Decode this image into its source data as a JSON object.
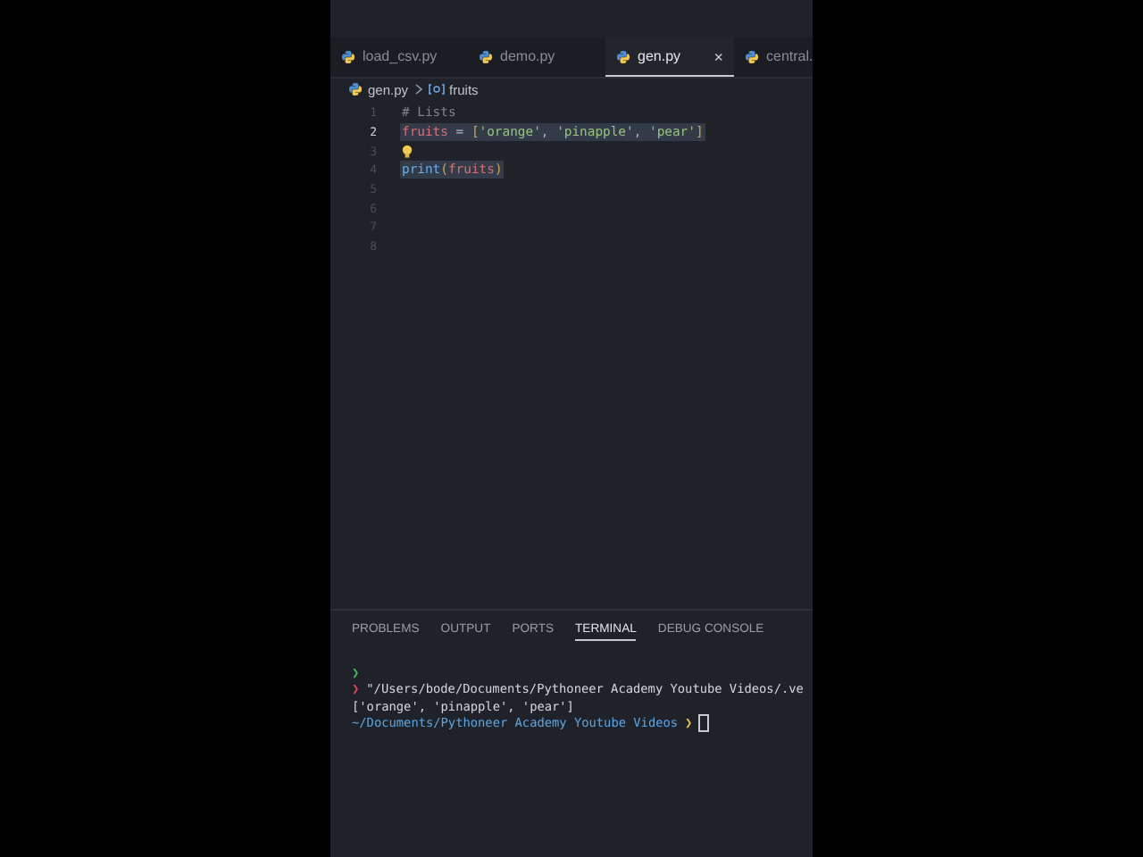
{
  "tabs": [
    {
      "label": "load_csv.py",
      "selected": false
    },
    {
      "label": "demo.py",
      "selected": false
    },
    {
      "label": "gen.py",
      "selected": true,
      "close": "×"
    },
    {
      "label": "central.",
      "selected": false
    }
  ],
  "breadcrumb": {
    "file": "gen.py",
    "symbol": "fruits"
  },
  "lines": [
    {
      "number": "1",
      "active": false,
      "highlighted": false,
      "tokens": [
        {
          "kind": "comment",
          "text": "# Lists"
        }
      ]
    },
    {
      "number": "2",
      "active": true,
      "highlighted": true,
      "tokens": [
        {
          "kind": "variable",
          "text": "fruits"
        },
        {
          "kind": "plain",
          "text": " = "
        },
        {
          "kind": "punct",
          "text": "["
        },
        {
          "kind": "string",
          "text": "'orange'"
        },
        {
          "kind": "plain",
          "text": ", "
        },
        {
          "kind": "string",
          "text": "'pinapple'"
        },
        {
          "kind": "plain",
          "text": ", "
        },
        {
          "kind": "string",
          "text": "'pear'"
        },
        {
          "kind": "punct",
          "text": "]"
        }
      ]
    },
    {
      "number": "3",
      "active": false,
      "lightbulb": true
    },
    {
      "number": "4",
      "active": false,
      "highlighted": true,
      "tokens": [
        {
          "kind": "function",
          "text": "print"
        },
        {
          "kind": "punct",
          "text": "("
        },
        {
          "kind": "variable",
          "text": "fruits"
        },
        {
          "kind": "punct",
          "text": ")"
        }
      ]
    },
    {
      "number": "5",
      "active": false
    },
    {
      "number": "6",
      "active": false
    },
    {
      "number": "7",
      "active": false
    },
    {
      "number": "8",
      "active": false
    }
  ],
  "panel_tabs": [
    {
      "label": "PROBLEMS",
      "selected": false
    },
    {
      "label": "OUTPUT",
      "selected": false
    },
    {
      "label": "PORTS",
      "selected": false
    },
    {
      "label": "TERMINAL",
      "selected": true
    },
    {
      "label": "DEBUG CONSOLE",
      "selected": false
    }
  ],
  "terminal": [
    {
      "kind": "prompt",
      "marker": "❯"
    },
    {
      "kind": "command",
      "marker": "❯",
      "text": "\"/Users/bode/Documents/Pythoneer Academy Youtube Videos/.ve"
    },
    {
      "kind": "output",
      "text": "['orange', 'pinapple', 'pear']"
    },
    {
      "kind": "cwd",
      "text": "~/Documents/Pythoneer Academy Youtube Videos",
      "marker": "❯"
    }
  ]
}
